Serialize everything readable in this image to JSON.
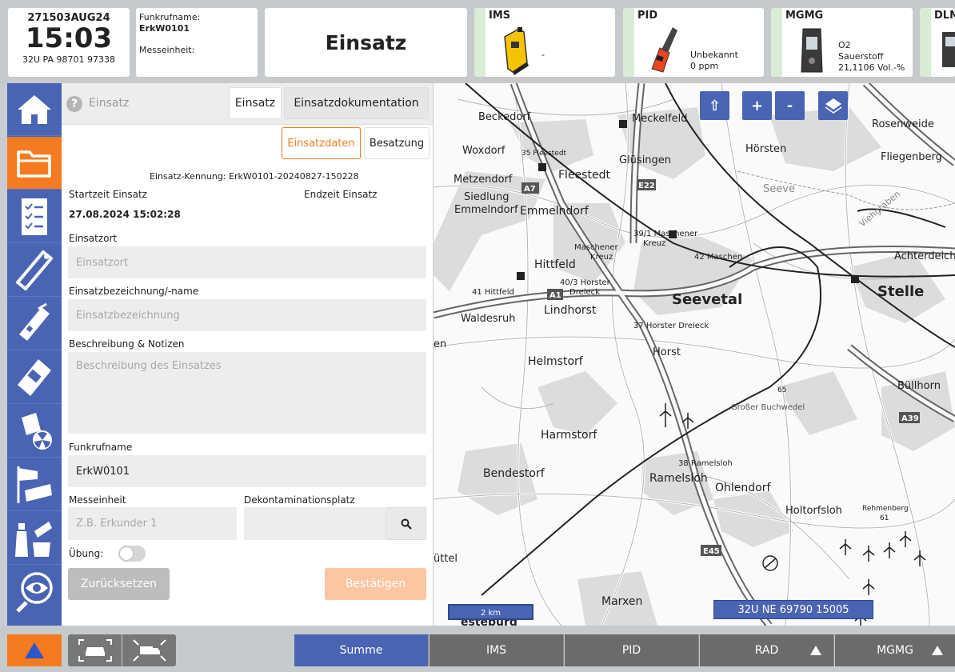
{
  "topbar": {
    "dtg": "271503AUG24",
    "time": "15:03",
    "utm": "32U PA 98701 97338",
    "funk_label": "Funkrufname:",
    "funk_value": "ErkW0101",
    "mess_label": "Messeinheit:",
    "mode": "Einsatz",
    "devices": [
      {
        "name": "IMS",
        "line1": "",
        "line2": "-"
      },
      {
        "name": "PID",
        "line1": "Unbekannt",
        "line2": "0 ppm"
      },
      {
        "name": "MGMG",
        "line1": "O2",
        "line2": "Sauerstoff",
        "line3": "21,1106 Vol.-%"
      },
      {
        "name": "DLM"
      }
    ]
  },
  "sidebar": {
    "icons": [
      "home-icon",
      "folder-icon",
      "checklist-icon",
      "ims-probe-icon",
      "pid-probe-icon",
      "gas-meter-icon",
      "dosimeter-radiation-icon",
      "windsock-sampling-icon",
      "sample-bottles-icon",
      "eye-magnifier-icon"
    ],
    "active_index": 1
  },
  "panel": {
    "title": "Einsatz",
    "tab_einsatz": "Einsatz",
    "tab_doku": "Einsatzdokumentation",
    "subtab_daten": "Einsatzdaten",
    "subtab_besatzung": "Besatzung",
    "kennung": "Einsatz-Kennung: ErkW0101-20240827-150228",
    "start_label": "Startzeit Einsatz",
    "end_label": "Endzeit Einsatz",
    "start_value": "27.08.2024 15:02:28",
    "ort_label": "Einsatzort",
    "ort_placeholder": "Einsatzort",
    "bez_label": "Einsatzbezeichnung/-name",
    "bez_placeholder": "Einsatzbezeichnung",
    "desc_label": "Beschreibung & Notizen",
    "desc_placeholder": "Beschreibung des Einsatzes",
    "funk_label": "Funkrufname",
    "funk_value": "ErkW0101",
    "mess_label": "Messeinheit",
    "mess_placeholder": "Z.B. Erkunder 1",
    "dekon_label": "Dekontaminationsplatz",
    "uebung_label": "Übung:",
    "reset": "Zurücksetzen",
    "confirm": "Bestätigen"
  },
  "map": {
    "btn_up": "⇧",
    "btn_plus": "+",
    "btn_minus": "-",
    "scale": "2 km",
    "coord": "32U NE 69790 15005",
    "labels": {
      "beckedorf": "Beckedorf",
      "meckelfeld": "Meckelfeld",
      "rosenweide": "Rosenweide",
      "woxdorf": "Woxdorf",
      "fleestedt35": "35 Fleestedt",
      "gluesingen": "Glüsingen",
      "hoersten": "Hörsten",
      "fliegenberg": "Fliegenberg",
      "metzendorf": "Metzendorf",
      "fleestedt": "Fleestedt",
      "siedlung": "Siedlung",
      "emmelndorf1": "Emmelndorf",
      "emmelndorf2": "Emmelndorf",
      "seeve": "Seeve",
      "viehgraben": "Viehgraben",
      "a7": "A7",
      "e22": "E22",
      "maschener391": "39/1 Maschener",
      "kreuz1": "Kreuz",
      "maschener": "Maschener",
      "kreuz2": "Kreuz",
      "maschen42": "42 Maschen",
      "achterdeich": "Achterdeich",
      "hittfeld": "Hittfeld",
      "horster402": "40/3 Horster",
      "dreieck1": "Dreieck",
      "hittfeld41": "41 Hittfeld",
      "seevetal": "Seevetal",
      "stelle": "Stelle",
      "a1": "A1",
      "lindhorst": "Lindhorst",
      "waldesruh": "Waldesruh",
      "horsterdreieck37": "37 Horster Dreieck",
      "en": "en",
      "horst": "Horst",
      "helmstorf": "Helmstorf",
      "buellhorn": "Büllhorn",
      "h65": "65",
      "grosser": "Großer Buchwedel",
      "a39": "A39",
      "harmstorf": "Harmstorf",
      "bendestorf": "Bendestorf",
      "ramelsloh38": "38 Ramelsloh",
      "ramelsloh": "Ramelsloh",
      "ohlendorf": "Ohlendorf",
      "holtorfsloh": "Holtorfsloh",
      "rehmenberg": "Rehmenberg",
      "h61": "61",
      "e45": "E45",
      "uttel": "üttel",
      "marxen": "Marxen",
      "esteburg": "esteburg"
    }
  },
  "bottombar": {
    "tabs": [
      "Summe",
      "IMS",
      "PID",
      "RAD",
      "MGMG"
    ],
    "active_tab": 0
  },
  "colors": {
    "accent_orange": "#f47b20",
    "primary_blue": "#4a64b4",
    "tab_gray": "#6b6b6b"
  }
}
